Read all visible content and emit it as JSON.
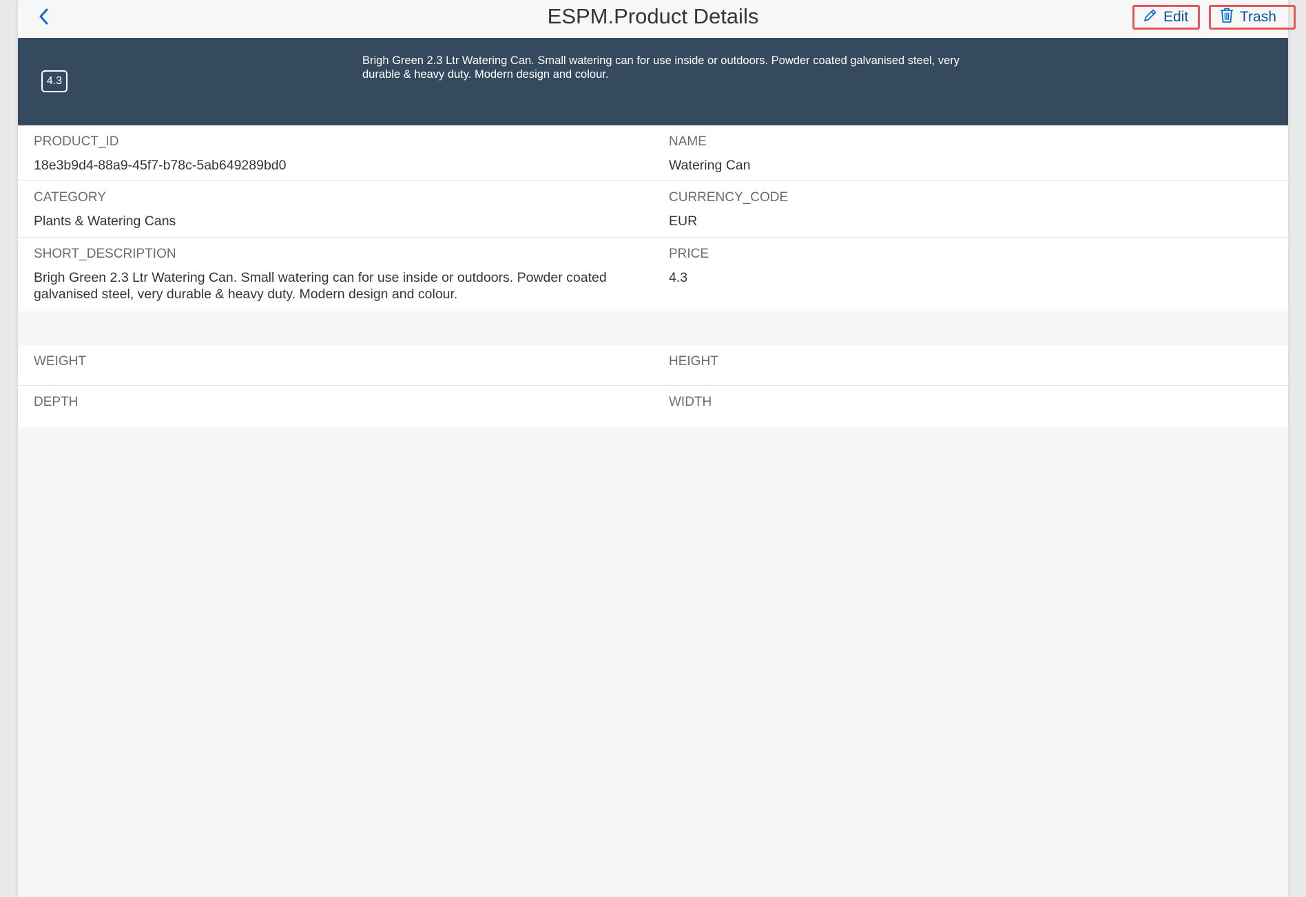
{
  "header": {
    "title": "ESPM.Product Details",
    "edit_label": "Edit",
    "trash_label": "Trash"
  },
  "object_header": {
    "badge": "4.3",
    "description": "Brigh Green 2.3 Ltr Watering Can. Small watering can for use inside or outdoors. Powder coated galvanised steel, very durable & heavy duty. Modern design and colour."
  },
  "details": {
    "product_id_label": "PRODUCT_ID",
    "product_id_value": "18e3b9d4-88a9-45f7-b78c-5ab649289bd0",
    "name_label": "NAME",
    "name_value": "Watering Can",
    "category_label": "CATEGORY",
    "category_value": "Plants & Watering Cans",
    "currency_label": "CURRENCY_CODE",
    "currency_value": "EUR",
    "short_desc_label": "SHORT_DESCRIPTION",
    "short_desc_value": "Brigh Green 2.3 Ltr Watering Can. Small watering can for use inside or outdoors. Powder coated galvanised steel, very durable & heavy duty. Modern design and colour.",
    "price_label": "PRICE",
    "price_value": "4.3"
  },
  "dimensions": {
    "weight_label": "WEIGHT",
    "height_label": "HEIGHT",
    "depth_label": "DEPTH",
    "width_label": "WIDTH"
  },
  "colors": {
    "header_band": "#354a5f",
    "accent": "#0a6ed1",
    "highlight": "#e25757"
  }
}
